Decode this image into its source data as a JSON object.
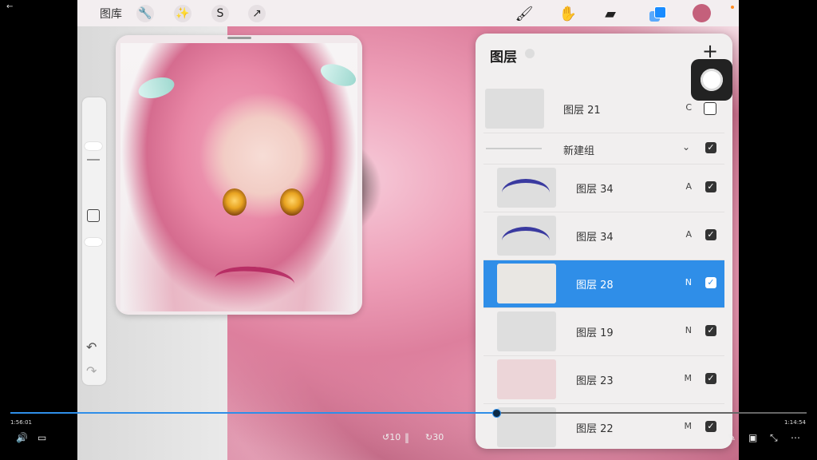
{
  "toolbar": {
    "gallery_label": "图库",
    "icons": [
      "wrench-icon",
      "magic-wand-icon",
      "selection-icon",
      "move-icon",
      "brush-icon",
      "smudge-icon",
      "eraser-icon",
      "layers-icon"
    ],
    "current_color": "#c4607b",
    "accent": "#1a8cff"
  },
  "sidebar": {
    "tools": [
      "brush-size-slider",
      "modify-button",
      "opacity-slider",
      "undo-icon",
      "redo-icon"
    ]
  },
  "layers_panel": {
    "title": "图层",
    "add_label": "+",
    "layers": [
      {
        "name": "图层 21",
        "mode": "C",
        "checked": false,
        "kind": "top"
      },
      {
        "name": "新建组",
        "mode": "",
        "checked": true,
        "kind": "group"
      },
      {
        "name": "图层 34",
        "mode": "A",
        "checked": true,
        "kind": "child"
      },
      {
        "name": "图层 34",
        "mode": "A",
        "checked": true,
        "kind": "child"
      },
      {
        "name": "图层 28",
        "mode": "N",
        "checked": true,
        "kind": "child",
        "selected": true
      },
      {
        "name": "图层 19",
        "mode": "N",
        "checked": true,
        "kind": "child"
      },
      {
        "name": "图层 23",
        "mode": "M",
        "checked": true,
        "kind": "child"
      },
      {
        "name": "图层 22",
        "mode": "M",
        "checked": true,
        "kind": "child"
      }
    ],
    "selected_color": "#2f8ee8"
  },
  "video": {
    "elapsed": "1:56:01",
    "remaining": "1:14:54",
    "progress": 0.61,
    "rewind_label": "10",
    "forward_label": "30"
  }
}
